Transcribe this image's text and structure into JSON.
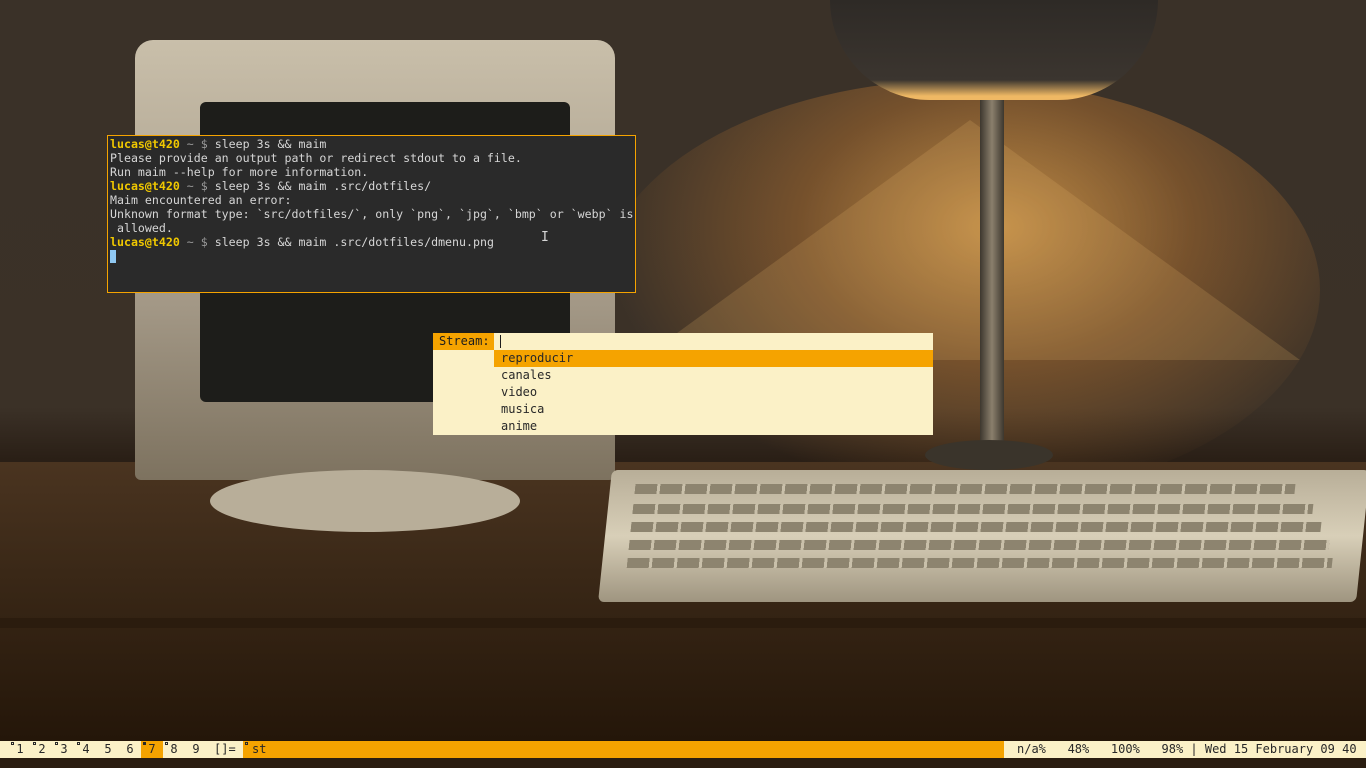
{
  "terminal": {
    "lines": [
      {
        "kind": "prompt",
        "user": "lucas@t420",
        "rest": " ~ $ ",
        "cmd": "sleep 3s && maim"
      },
      {
        "kind": "out",
        "text": "Please provide an output path or redirect stdout to a file."
      },
      {
        "kind": "out",
        "text": "Run maim --help for more information."
      },
      {
        "kind": "prompt",
        "user": "lucas@t420",
        "rest": " ~ $ ",
        "cmd": "sleep 3s && maim .src/dotfiles/"
      },
      {
        "kind": "out",
        "text": "Maim encountered an error:"
      },
      {
        "kind": "out",
        "text": "Unknown format type: `src/dotfiles/`, only `png`, `jpg`, `bmp` or `webp` is"
      },
      {
        "kind": "out",
        "text": " allowed."
      },
      {
        "kind": "prompt",
        "user": "lucas@t420",
        "rest": " ~ $ ",
        "cmd": "sleep 3s && maim .src/dotfiles/dmenu.png"
      }
    ],
    "ibeam": "I"
  },
  "dmenu": {
    "prompt": "Stream:",
    "input_value": "",
    "items": [
      "reproducir",
      "canales",
      "video",
      "musica",
      "anime"
    ],
    "selected_index": 0
  },
  "bar": {
    "tags": [
      {
        "label": "1",
        "occupied": true,
        "active": false
      },
      {
        "label": "2",
        "occupied": true,
        "active": false
      },
      {
        "label": "3",
        "occupied": true,
        "active": false
      },
      {
        "label": "4",
        "occupied": true,
        "active": false
      },
      {
        "label": "5",
        "occupied": false,
        "active": false
      },
      {
        "label": "6",
        "occupied": false,
        "active": false
      },
      {
        "label": "7",
        "occupied": true,
        "active": true
      },
      {
        "label": "8",
        "occupied": true,
        "active": false
      },
      {
        "label": "9",
        "occupied": false,
        "active": false
      }
    ],
    "layout_symbol": "[]=",
    "window_title": "st",
    "status": "n/a%   48%   100%   98% | Wed 15 February 09 40"
  },
  "colors": {
    "accent": "#f5a300",
    "bar_bg": "#fbf1c7",
    "terminal_bg": "#2a2a2a",
    "prompt_user": "#f0c800"
  }
}
